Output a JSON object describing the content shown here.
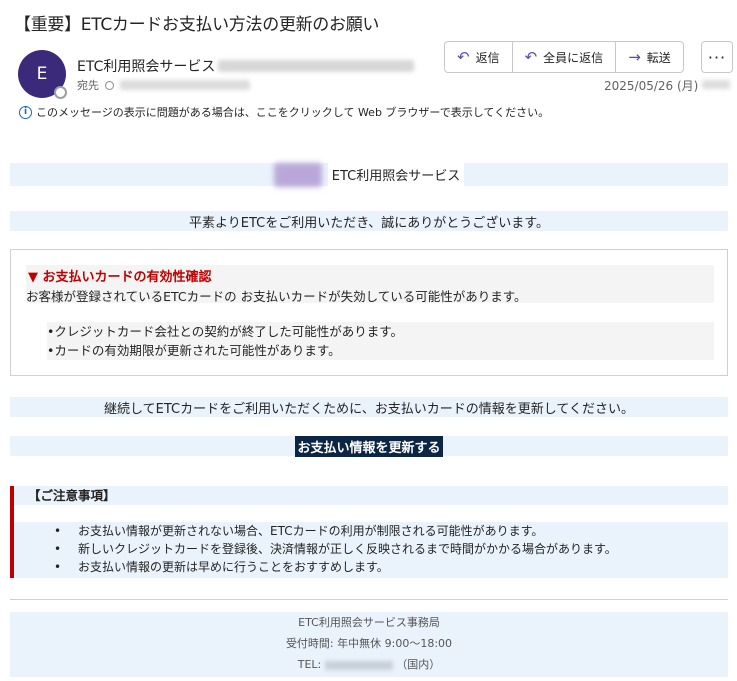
{
  "subject": "【重要】ETCカードお支払い方法の更新のお願い",
  "sender": {
    "avatar_letter": "E",
    "name": "ETC利用照会サービス",
    "to_label": "宛先"
  },
  "actions": [
    {
      "label": "返信",
      "icon": "reply-icon",
      "glyph": "↶"
    },
    {
      "label": "全員に返信",
      "icon": "reply-all-icon",
      "glyph": "↶"
    },
    {
      "label": "転送",
      "icon": "forward-icon",
      "glyph": "→"
    }
  ],
  "more_glyph": "···",
  "date": "2025/05/26 (月)",
  "info_bar": "このメッセージの表示に問題がある場合は、ここをクリックして Web ブラウザーで表示してください。",
  "body": {
    "logo_text": "ETC利用照会サービス",
    "greeting": "平素よりETCをご利用いただき、誠にありがとうございます。",
    "alert_title": "▼ お支払いカードの有効性確認",
    "alert_text": "お客様が登録されているETCカードの お支払いカードが失効している可能性があります。",
    "alert_items": [
      "•クレジットカード会社との契約が終了した可能性があります。",
      "•カードの有効期限が更新された可能性があります。"
    ],
    "continue_text": "継続してETCカードをご利用いただくために、お支払いカードの情報を更新してください。",
    "cta_label": "お支払い情報を更新する",
    "notice_title": "【ご注意事項】",
    "notice_items": [
      "お支払い情報が更新されない場合、ETCカードの利用が制限される可能性があります。",
      "新しいクレジットカードを登録後、決済情報が正しく反映されるまで時間がかかる場合があります。",
      "お支払い情報の更新は早めに行うことをおすすめします。"
    ],
    "footer_org": "ETC利用照会サービス事務局",
    "footer_hours": "受付時間: 年中無休 9:00～18:00",
    "footer_tel_label": "TEL:",
    "footer_tel_suffix": "（国内）"
  },
  "colors": {
    "accent": "#5b4bb7",
    "alert_red": "#c00000",
    "band_bg": "#eaf3fc",
    "cta_bg": "#0b2545"
  }
}
